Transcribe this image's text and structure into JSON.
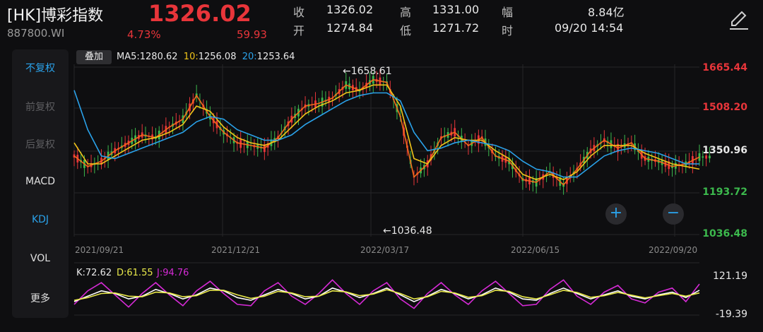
{
  "header": {
    "title": "[HK]博彩指数",
    "code": "887800.WI",
    "price": "1326.02",
    "change_pct": "4.73%",
    "change": "59.93",
    "stats": [
      {
        "label": "收",
        "value": "1326.02"
      },
      {
        "label": "高",
        "value": "1331.00"
      },
      {
        "label": "幅",
        "value": "8.84亿"
      },
      {
        "label": "开",
        "value": "1274.84"
      },
      {
        "label": "低",
        "value": "1271.72"
      },
      {
        "label": "时",
        "value": "09/20 14:54"
      }
    ],
    "edit_icon": "pencil-icon"
  },
  "sidebar": {
    "items": [
      "不复权",
      "前复权",
      "后复权",
      "MACD",
      "KDJ",
      "VOL",
      "更多"
    ]
  },
  "overlay_label": "叠加",
  "ma_legend": {
    "ma5_label": "MA5:",
    "ma5": "1280.62",
    "ma10_label": "10:",
    "ma10": "1256.08",
    "ma20_label": "20:",
    "ma20": "1253.64"
  },
  "zoom": {
    "in": "+",
    "out": "−"
  },
  "colors": {
    "up": "#e8353a",
    "down": "#3cb94d",
    "ma5": "#f26a1b",
    "ma10": "#f0c419",
    "ma20": "#2aa2ea",
    "k": "#ffffff",
    "d": "#e8e84a",
    "j": "#d62ad6"
  },
  "chart_data": [
    {
      "type": "line",
      "name": "price",
      "x_ticks": [
        "2021/09/21",
        "2021/12/21",
        "2022/03/17",
        "2022/06/15",
        "2022/09/20"
      ],
      "y_ticks": [
        "1665.44",
        "1508.20",
        "1350.96",
        "1193.72",
        "1036.48"
      ],
      "ylim": [
        1036.48,
        1665.44
      ],
      "annotations": [
        {
          "text": "1658.61",
          "label": "←1658.61",
          "x": "2022/03/17"
        },
        {
          "text": "1036.48",
          "label": "←1036.48",
          "x": "2022/03/17"
        }
      ],
      "series": [
        {
          "name": "MA5",
          "values": [
            1330,
            1290,
            1310,
            1350,
            1380,
            1410,
            1400,
            1440,
            1470,
            1560,
            1480,
            1420,
            1380,
            1370,
            1360,
            1400,
            1470,
            1520,
            1530,
            1550,
            1600,
            1580,
            1620,
            1610,
            1480,
            1250,
            1300,
            1400,
            1420,
            1370,
            1400,
            1330,
            1310,
            1240,
            1230,
            1270,
            1220,
            1280,
            1350,
            1390,
            1360,
            1380,
            1320,
            1310,
            1290,
            1300,
            1326
          ]
        },
        {
          "name": "10",
          "values": [
            1380,
            1300,
            1300,
            1330,
            1360,
            1390,
            1400,
            1420,
            1450,
            1520,
            1500,
            1440,
            1400,
            1380,
            1370,
            1390,
            1440,
            1490,
            1520,
            1540,
            1570,
            1580,
            1600,
            1600,
            1520,
            1320,
            1300,
            1370,
            1400,
            1390,
            1390,
            1350,
            1320,
            1260,
            1240,
            1260,
            1240,
            1270,
            1330,
            1370,
            1370,
            1370,
            1340,
            1320,
            1300,
            1290,
            1280
          ]
        },
        {
          "name": "20",
          "values": [
            1580,
            1430,
            1330,
            1320,
            1340,
            1360,
            1380,
            1400,
            1420,
            1460,
            1480,
            1470,
            1430,
            1410,
            1390,
            1390,
            1410,
            1450,
            1480,
            1510,
            1540,
            1560,
            1570,
            1570,
            1540,
            1420,
            1350,
            1360,
            1380,
            1390,
            1380,
            1370,
            1350,
            1310,
            1280,
            1270,
            1250,
            1250,
            1290,
            1330,
            1350,
            1360,
            1350,
            1340,
            1320,
            1300,
            1300
          ]
        }
      ]
    },
    {
      "type": "line",
      "name": "KDJ",
      "y_ticks": [
        "121.19",
        "-19.39"
      ],
      "ylim": [
        -19.39,
        121.19
      ],
      "labels": {
        "k": "K:72.62",
        "d": "D:61.55",
        "j": "J:94.76"
      },
      "series": [
        {
          "name": "K",
          "values": [
            30,
            50,
            70,
            60,
            40,
            50,
            75,
            60,
            40,
            55,
            80,
            70,
            45,
            35,
            55,
            75,
            60,
            40,
            50,
            80,
            65,
            45,
            60,
            80,
            55,
            30,
            50,
            75,
            60,
            40,
            55,
            80,
            65,
            40,
            35,
            60,
            80,
            60,
            40,
            55,
            70,
            50,
            40,
            55,
            65,
            45,
            72
          ]
        },
        {
          "name": "D",
          "values": [
            35,
            45,
            60,
            62,
            50,
            48,
            65,
            62,
            48,
            52,
            72,
            72,
            55,
            42,
            50,
            68,
            62,
            48,
            50,
            70,
            66,
            52,
            58,
            74,
            60,
            40,
            48,
            68,
            62,
            46,
            52,
            72,
            68,
            48,
            40,
            55,
            72,
            64,
            46,
            52,
            64,
            54,
            44,
            52,
            60,
            50,
            62
          ]
        },
        {
          "name": "J",
          "values": [
            20,
            70,
            100,
            55,
            10,
            60,
            100,
            55,
            15,
            70,
            105,
            60,
            20,
            15,
            70,
            100,
            50,
            20,
            60,
            110,
            60,
            20,
            70,
            100,
            40,
            5,
            60,
            100,
            55,
            20,
            70,
            105,
            60,
            15,
            20,
            75,
            110,
            50,
            20,
            65,
            90,
            40,
            25,
            65,
            80,
            30,
            95
          ]
        }
      ]
    }
  ]
}
